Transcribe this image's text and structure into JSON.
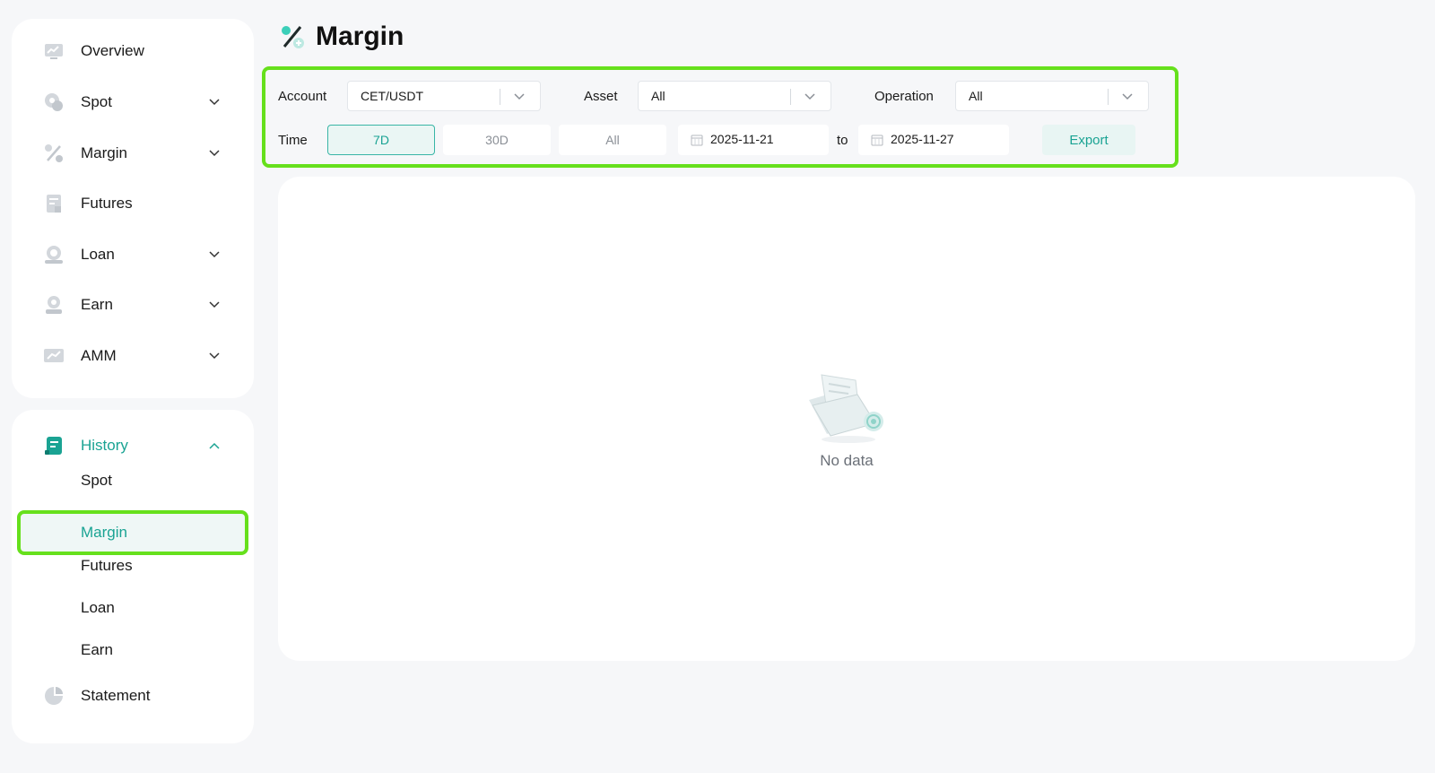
{
  "sidebar": {
    "main_items": [
      {
        "label": "Overview",
        "icon": "chart-screen-icon",
        "has_chevron": false
      },
      {
        "label": "Spot",
        "icon": "coins-icon",
        "has_chevron": true
      },
      {
        "label": "Margin",
        "icon": "percent-icon",
        "has_chevron": true
      },
      {
        "label": "Futures",
        "icon": "document-icon",
        "has_chevron": false
      },
      {
        "label": "Loan",
        "icon": "coin-stack-icon",
        "has_chevron": true
      },
      {
        "label": "Earn",
        "icon": "coin-hand-icon",
        "has_chevron": true
      },
      {
        "label": "AMM",
        "icon": "trend-screen-icon",
        "has_chevron": true
      }
    ],
    "history": {
      "label": "History",
      "icon": "history-book-icon",
      "expanded": true,
      "sub_items": [
        {
          "label": "Spot"
        },
        {
          "label": "Margin",
          "active": true
        },
        {
          "label": "Futures"
        },
        {
          "label": "Loan"
        },
        {
          "label": "Earn"
        }
      ]
    },
    "statement": {
      "label": "Statement",
      "icon": "pie-chart-icon"
    }
  },
  "header": {
    "title": "Margin",
    "icon": "percent-icon"
  },
  "filters": {
    "account": {
      "label": "Account",
      "value": "CET/USDT"
    },
    "asset": {
      "label": "Asset",
      "value": "All"
    },
    "operation": {
      "label": "Operation",
      "value": "All"
    },
    "time": {
      "label": "Time",
      "options": [
        "7D",
        "30D",
        "All"
      ],
      "selected": "7D"
    },
    "date_from": "2025-11-21",
    "date_separator": "to",
    "date_to": "2025-11-27",
    "export_label": "Export"
  },
  "content": {
    "empty_text": "No data",
    "empty_icon": "empty-folder-icon"
  },
  "colors": {
    "accent": "#1aa393",
    "highlight_border": "#66e01c",
    "icon_gray": "#c9ced4"
  }
}
